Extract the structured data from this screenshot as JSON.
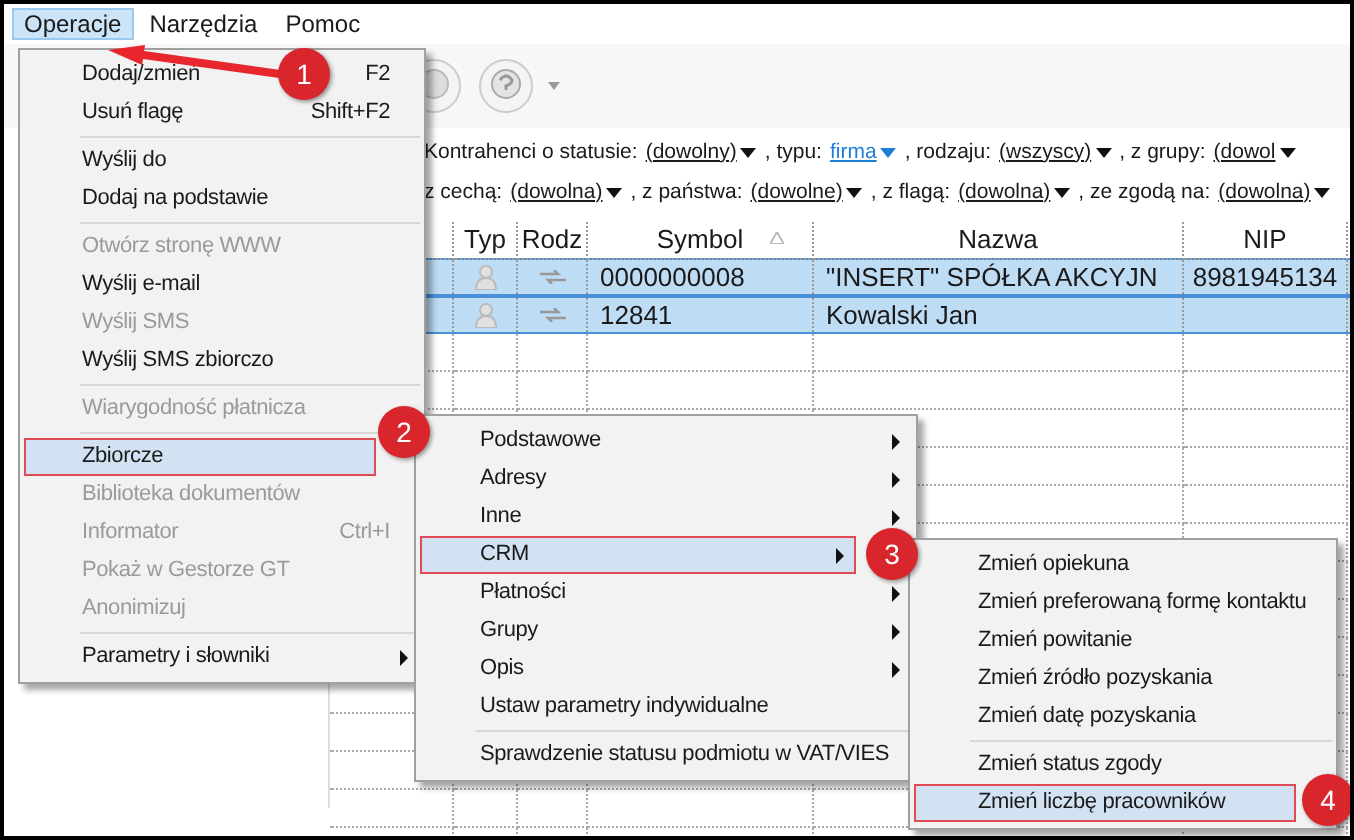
{
  "menubar": [
    {
      "label": "Operacje",
      "selected": true
    },
    {
      "label": "Narzędzia",
      "selected": false
    },
    {
      "label": "Pomoc",
      "selected": false
    }
  ],
  "filters": [
    [
      {
        "label": "Kontrahenci o statusie:",
        "value": "(dowolny)",
        "highlighted": false
      },
      {
        "label": ", typu:",
        "value": "firma",
        "highlighted": true
      },
      {
        "label": ", rodzaju:",
        "value": "(wszyscy)",
        "highlighted": false
      },
      {
        "label": ", z grupy:",
        "value": "(dowol",
        "highlighted": false
      }
    ],
    [
      {
        "label": "z cechą:",
        "value": "(dowolna)",
        "highlighted": false
      },
      {
        "label": ", z państwa:",
        "value": "(dowolne)",
        "highlighted": false
      },
      {
        "label": ", z flagą:",
        "value": "(dowolna)",
        "highlighted": false
      },
      {
        "label": ", ze zgodą na:",
        "value": "(dowolna)",
        "highlighted": false
      }
    ]
  ],
  "table": {
    "columns": [
      "",
      "Typ",
      "Rodz",
      "Symbol",
      "Nazwa",
      "NIP"
    ],
    "rows": [
      {
        "symbol": "0000000008",
        "nazwa": "\"INSERT\" SPÓŁKA AKCYJN",
        "nip": "8981945134",
        "selected": true
      },
      {
        "symbol": "12841",
        "nazwa": "Kowalski Jan",
        "nip": "",
        "selected": true
      }
    ]
  },
  "menus": [
    {
      "items": [
        {
          "kind": "item",
          "label": "Dodaj/zmień",
          "shortcut": "F2",
          "disabled": false,
          "selected": false,
          "submenu": false
        },
        {
          "kind": "item",
          "label": "Usuń flagę",
          "shortcut": "Shift+F2",
          "disabled": false,
          "selected": false,
          "submenu": false
        },
        {
          "kind": "separator"
        },
        {
          "kind": "item",
          "label": "Wyślij do",
          "disabled": false,
          "selected": false,
          "submenu": false
        },
        {
          "kind": "item",
          "label": "Dodaj na podstawie",
          "disabled": false,
          "selected": false,
          "submenu": false
        },
        {
          "kind": "separator"
        },
        {
          "kind": "item",
          "label": "Otwórz stronę WWW",
          "disabled": true,
          "selected": false,
          "submenu": false
        },
        {
          "kind": "item",
          "label": "Wyślij e-mail",
          "disabled": false,
          "selected": false,
          "submenu": false
        },
        {
          "kind": "item",
          "label": "Wyślij SMS",
          "disabled": true,
          "selected": false,
          "submenu": false
        },
        {
          "kind": "item",
          "label": "Wyślij SMS zbiorczo",
          "disabled": false,
          "selected": false,
          "submenu": false
        },
        {
          "kind": "separator"
        },
        {
          "kind": "item",
          "label": "Wiarygodność płatnicza",
          "disabled": true,
          "selected": false,
          "submenu": false
        },
        {
          "kind": "separator"
        },
        {
          "kind": "item",
          "label": "Zbiorcze",
          "disabled": false,
          "selected": true,
          "submenu": false
        },
        {
          "kind": "item",
          "label": "Biblioteka dokumentów",
          "disabled": true,
          "selected": false,
          "submenu": false
        },
        {
          "kind": "item",
          "label": "Informator",
          "shortcut": "Ctrl+I",
          "disabled": true,
          "selected": false,
          "submenu": false
        },
        {
          "kind": "item",
          "label": "Pokaż w Gestorze GT",
          "disabled": true,
          "selected": false,
          "submenu": false
        },
        {
          "kind": "item",
          "label": "Anonimizuj",
          "disabled": true,
          "selected": false,
          "submenu": false
        },
        {
          "kind": "separator"
        },
        {
          "kind": "item",
          "label": "Parametry i słowniki",
          "disabled": false,
          "selected": false,
          "submenu": true
        }
      ]
    },
    {
      "items": [
        {
          "kind": "item",
          "label": "Podstawowe",
          "disabled": false,
          "selected": false,
          "submenu": true
        },
        {
          "kind": "item",
          "label": "Adresy",
          "disabled": false,
          "selected": false,
          "submenu": true
        },
        {
          "kind": "item",
          "label": "Inne",
          "disabled": false,
          "selected": false,
          "submenu": true
        },
        {
          "kind": "item",
          "label": "CRM",
          "disabled": false,
          "selected": true,
          "submenu": true
        },
        {
          "kind": "item",
          "label": "Płatności",
          "disabled": false,
          "selected": false,
          "submenu": true
        },
        {
          "kind": "item",
          "label": "Grupy",
          "disabled": false,
          "selected": false,
          "submenu": true
        },
        {
          "kind": "item",
          "label": "Opis",
          "disabled": false,
          "selected": false,
          "submenu": true
        },
        {
          "kind": "item",
          "label": "Ustaw parametry indywidualne",
          "disabled": false,
          "selected": false,
          "submenu": false
        },
        {
          "kind": "separator"
        },
        {
          "kind": "item",
          "label": "Sprawdzenie statusu podmiotu w VAT/VIES",
          "disabled": false,
          "selected": false,
          "submenu": false
        }
      ]
    },
    {
      "items": [
        {
          "kind": "item",
          "label": "Zmień opiekuna",
          "disabled": false,
          "selected": false,
          "submenu": false
        },
        {
          "kind": "item",
          "label": "Zmień preferowaną formę kontaktu",
          "disabled": false,
          "selected": false,
          "submenu": false
        },
        {
          "kind": "item",
          "label": "Zmień powitanie",
          "disabled": false,
          "selected": false,
          "submenu": false
        },
        {
          "kind": "item",
          "label": "Zmień źródło pozyskania",
          "disabled": false,
          "selected": false,
          "submenu": false
        },
        {
          "kind": "item",
          "label": "Zmień datę pozyskania",
          "disabled": false,
          "selected": false,
          "submenu": false
        },
        {
          "kind": "separator"
        },
        {
          "kind": "item",
          "label": "Zmień status zgody",
          "disabled": false,
          "selected": false,
          "submenu": false
        },
        {
          "kind": "item",
          "label": "Zmień liczbę pracowników",
          "disabled": false,
          "selected": true,
          "submenu": false
        }
      ]
    }
  ],
  "annotations": [
    {
      "label": "1"
    },
    {
      "label": "2"
    },
    {
      "label": "3"
    },
    {
      "label": "4"
    }
  ]
}
